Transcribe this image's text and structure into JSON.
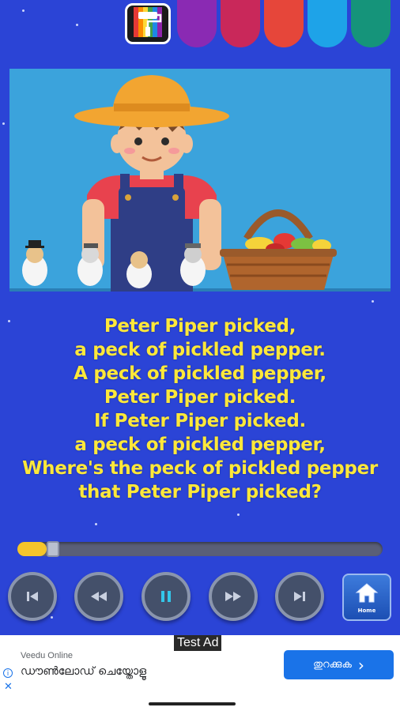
{
  "colors": {
    "background": "#2b44d6",
    "lyrics": "#ffe83a",
    "swatches": [
      "#8a2ab3",
      "#c9285a",
      "#e6463a",
      "#1ea3e8",
      "#15947a"
    ]
  },
  "toolbar": {
    "theme_icon": "paint-roller-icon"
  },
  "lyrics": [
    "Peter Piper picked,",
    "a peck of pickled pepper.",
    "A peck of pickled pepper,",
    "Peter Piper picked.",
    "If Peter Piper picked.",
    "a peck of pickled pepper,",
    "Where's the peck of pickled pepper",
    "that Peter Piper picked?"
  ],
  "player": {
    "progress_fraction": 0.08,
    "controls": [
      "skip-previous-icon",
      "rewind-icon",
      "pause-icon",
      "fast-forward-icon",
      "skip-next-icon"
    ],
    "home_label": "Home"
  },
  "ad": {
    "tag": "Test Ad",
    "source": "Veedu Online",
    "text": "ഡൗൺലോഡ് ചെയ്തോളൂ",
    "button": "തുറക്കുക",
    "info_icon": "i",
    "close_icon": "✕",
    "chevron": "›"
  }
}
